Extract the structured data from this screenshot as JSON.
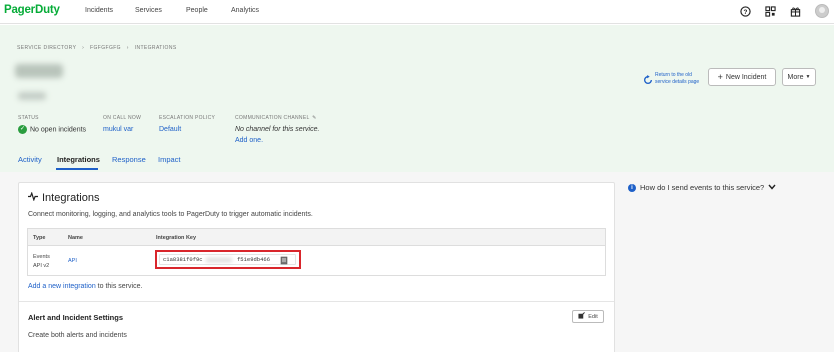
{
  "app": {
    "logo": "PagerDuty"
  },
  "nav": {
    "items": [
      {
        "label": "Incidents"
      },
      {
        "label": "Services"
      },
      {
        "label": "People"
      },
      {
        "label": "Analytics"
      }
    ],
    "icons": [
      "help-icon",
      "apps-grid-icon",
      "gift-icon",
      "user-avatar"
    ]
  },
  "breadcrumb": [
    "SERVICE DIRECTORY",
    "›",
    "FGFGFGFG",
    "›",
    "INTEGRATIONS"
  ],
  "header": {
    "old_details_link": "Return to the old service details page",
    "new_incident_label": "New Incident",
    "more_label": "More"
  },
  "meta": {
    "status": {
      "label": "STATUS",
      "value": "No open incidents"
    },
    "on_call": {
      "label": "ON CALL NOW",
      "value": "mukul var"
    },
    "escalation": {
      "label": "ESCALATION POLICY",
      "value": "Default"
    },
    "communication": {
      "label": "COMMUNICATION CHANNEL",
      "value": "No channel for this service.",
      "action": "Add one."
    }
  },
  "tabs": [
    {
      "label": "Activity",
      "active": false
    },
    {
      "label": "Integrations",
      "active": true
    },
    {
      "label": "Response",
      "active": false
    },
    {
      "label": "Impact",
      "active": false
    }
  ],
  "integrations": {
    "title": "Integrations",
    "description": "Connect monitoring, logging, and analytics tools to PagerDuty to trigger automatic incidents.",
    "table": {
      "headers": [
        "Type",
        "Name",
        "Integration Key"
      ],
      "rows": [
        {
          "type_line1": "Events",
          "type_line2": "API v2",
          "name": "API",
          "key_start": "c1a8381f0f9c",
          "key_end": "f51e9db466"
        }
      ]
    },
    "add_link": "Add a new integration",
    "add_suffix": "to this service."
  },
  "alert_settings": {
    "title": "Alert and Incident Settings",
    "description": "Create both alerts and incidents",
    "edit_label": "Edit"
  },
  "help": {
    "question": "How do I send events to this service?"
  },
  "colors": {
    "brand": "#06ac38",
    "link": "#1e60c8",
    "highlight": "#d9262c",
    "header_bg": "#eef7ef"
  }
}
